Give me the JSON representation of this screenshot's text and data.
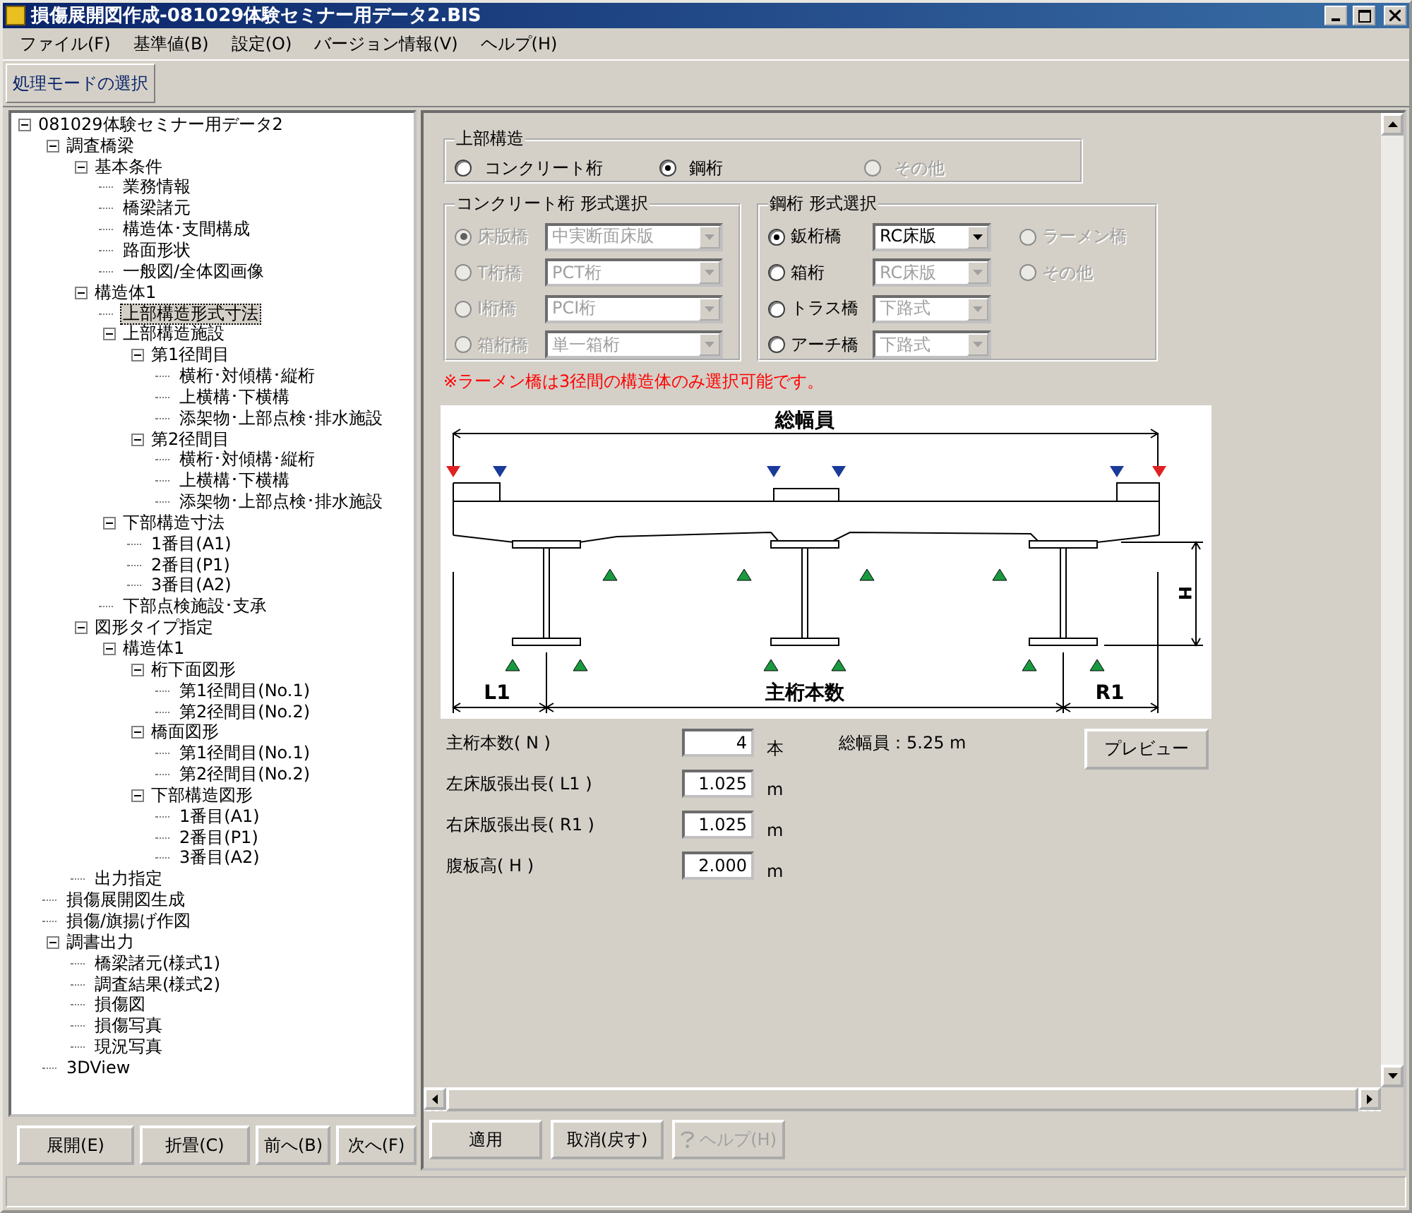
{
  "window": {
    "title": "損傷展開図作成-081029体験セミナー用データ2.BIS"
  },
  "menu": [
    "ファイル(F)",
    "基準値(B)",
    "設定(O)",
    "バージョン情報(V)",
    "ヘルプ(H)"
  ],
  "toolbar": {
    "mode_button": "処理モードの選択"
  },
  "tree": {
    "nodes": [
      {
        "label": "081029体験セミナー用データ2",
        "selected": false,
        "expanded": true,
        "children": [
          {
            "label": "調査橋梁",
            "selected": false,
            "expanded": true,
            "children": [
              {
                "label": "基本条件",
                "selected": false,
                "expanded": true,
                "children": [
                  {
                    "label": "業務情報",
                    "selected": false
                  },
                  {
                    "label": "橋梁諸元",
                    "selected": false
                  },
                  {
                    "label": "構造体･支間構成",
                    "selected": false
                  },
                  {
                    "label": "路面形状",
                    "selected": false
                  },
                  {
                    "label": "一般図/全体図画像",
                    "selected": false
                  }
                ]
              },
              {
                "label": "構造体1",
                "selected": false,
                "expanded": true,
                "children": [
                  {
                    "label": "上部構造形式寸法",
                    "selected": true
                  },
                  {
                    "label": "上部構造施設",
                    "selected": false,
                    "expanded": true,
                    "children": [
                      {
                        "label": "第1径間目",
                        "selected": false,
                        "expanded": true,
                        "children": [
                          {
                            "label": "横桁･対傾構･縦桁",
                            "selected": false
                          },
                          {
                            "label": "上横構･下横構",
                            "selected": false
                          },
                          {
                            "label": "添架物･上部点検･排水施設",
                            "selected": false
                          }
                        ]
                      },
                      {
                        "label": "第2径間目",
                        "selected": false,
                        "expanded": true,
                        "children": [
                          {
                            "label": "横桁･対傾構･縦桁",
                            "selected": false
                          },
                          {
                            "label": "上横構･下横構",
                            "selected": false
                          },
                          {
                            "label": "添架物･上部点検･排水施設",
                            "selected": false
                          }
                        ]
                      }
                    ]
                  },
                  {
                    "label": "下部構造寸法",
                    "selected": false,
                    "expanded": true,
                    "children": [
                      {
                        "label": "1番目(A1)",
                        "selected": false
                      },
                      {
                        "label": "2番目(P1)",
                        "selected": false
                      },
                      {
                        "label": "3番目(A2)",
                        "selected": false
                      }
                    ]
                  },
                  {
                    "label": "下部点検施設･支承",
                    "selected": false
                  }
                ]
              },
              {
                "label": "図形タイプ指定",
                "selected": false,
                "expanded": true,
                "children": [
                  {
                    "label": "構造体1",
                    "selected": false,
                    "expanded": true,
                    "children": [
                      {
                        "label": "桁下面図形",
                        "selected": false,
                        "expanded": true,
                        "children": [
                          {
                            "label": "第1径間目(No.1)",
                            "selected": false
                          },
                          {
                            "label": "第2径間目(No.2)",
                            "selected": false
                          }
                        ]
                      },
                      {
                        "label": "橋面図形",
                        "selected": false,
                        "expanded": true,
                        "children": [
                          {
                            "label": "第1径間目(No.1)",
                            "selected": false
                          },
                          {
                            "label": "第2径間目(No.2)",
                            "selected": false
                          }
                        ]
                      },
                      {
                        "label": "下部構造図形",
                        "selected": false,
                        "expanded": true,
                        "children": [
                          {
                            "label": "1番目(A1)",
                            "selected": false
                          },
                          {
                            "label": "2番目(P1)",
                            "selected": false
                          },
                          {
                            "label": "3番目(A2)",
                            "selected": false
                          }
                        ]
                      }
                    ]
                  }
                ]
              },
              {
                "label": "出力指定",
                "selected": false
              }
            ]
          },
          {
            "label": "損傷展開図生成",
            "selected": false
          },
          {
            "label": "損傷/旗揚げ作図",
            "selected": false
          },
          {
            "label": "調書出力",
            "selected": false,
            "expanded": true,
            "children": [
              {
                "label": "橋梁諸元(様式1)",
                "selected": false
              },
              {
                "label": "調査結果(様式2)",
                "selected": false
              },
              {
                "label": "損傷図",
                "selected": false
              },
              {
                "label": "損傷写真",
                "selected": false
              },
              {
                "label": "現況写真",
                "selected": false
              }
            ]
          },
          {
            "label": "3DView",
            "selected": false
          }
        ]
      }
    ]
  },
  "tree_buttons": [
    "展開(E)",
    "折畳(C)",
    "前へ(B)",
    "次へ(F)"
  ],
  "superstructure": {
    "title": "上部構造",
    "options": [
      {
        "label": "コンクリート桁",
        "selected": false,
        "disabled": false
      },
      {
        "label": "鋼桁",
        "selected": true,
        "disabled": false
      },
      {
        "label": "その他",
        "selected": false,
        "disabled": true
      }
    ]
  },
  "concrete_type": {
    "title": "コンクリート桁 形式選択",
    "rows": [
      {
        "label": "床版橋",
        "selected": true,
        "disabled": true,
        "combo": "中実断面床版",
        "combo_disabled": true
      },
      {
        "label": "T桁橋",
        "selected": false,
        "disabled": true,
        "combo": "PCT桁",
        "combo_disabled": true
      },
      {
        "label": "I桁橋",
        "selected": false,
        "disabled": true,
        "combo": "PCI桁",
        "combo_disabled": true
      },
      {
        "label": "箱桁橋",
        "selected": false,
        "disabled": true,
        "combo": "単一箱桁",
        "combo_disabled": true
      }
    ]
  },
  "steel_type": {
    "title": "鋼桁 形式選択",
    "rows": [
      {
        "label": "鈑桁橋",
        "selected": true,
        "disabled": false,
        "combo": "RC床版",
        "combo_disabled": false
      },
      {
        "label": "箱桁",
        "selected": false,
        "disabled": false,
        "combo": "RC床版",
        "combo_disabled": true
      },
      {
        "label": "トラス橋",
        "selected": false,
        "disabled": false,
        "combo": "下路式",
        "combo_disabled": true
      },
      {
        "label": "アーチ橋",
        "selected": false,
        "disabled": false,
        "combo": "下路式",
        "combo_disabled": true
      }
    ],
    "extra_options": [
      {
        "label": "ラーメン橋",
        "selected": false,
        "disabled": true
      },
      {
        "label": "その他",
        "selected": false,
        "disabled": true
      }
    ]
  },
  "note": "※ラーメン橋は3径間の構造体のみ選択可能です。",
  "diagram": {
    "total_width": "総幅員",
    "left": "L1",
    "girders": "主桁本数",
    "right": "R1",
    "height": "H"
  },
  "fields": [
    {
      "label": "主桁本数( N )",
      "value": "4",
      "unit": "本"
    },
    {
      "label": "左床版張出長( L1 )",
      "value": "1.025",
      "unit": "m"
    },
    {
      "label": "右床版張出長( R1 )",
      "value": "1.025",
      "unit": "m"
    },
    {
      "label": "腹板高( H )",
      "value": "2.000",
      "unit": "m"
    }
  ],
  "total_width": "総幅員：5.25 m",
  "preview_button": "プレビュー",
  "buttons": [
    {
      "label": "適用",
      "disabled": false
    },
    {
      "label": "取消(戻す)",
      "disabled": false
    },
    {
      "label": "ヘルプ(H)",
      "disabled": true
    }
  ]
}
